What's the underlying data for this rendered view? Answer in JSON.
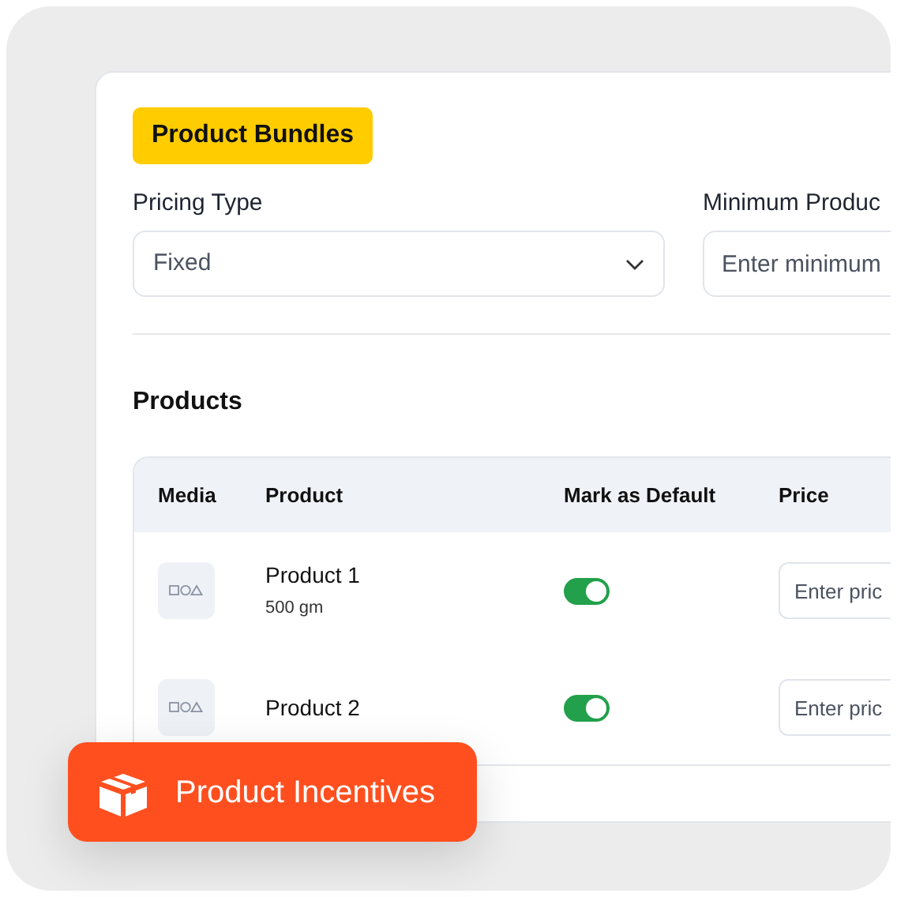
{
  "section_badge": "Product Bundles",
  "pricing_type": {
    "label": "Pricing Type",
    "value": "Fixed"
  },
  "minimum_products": {
    "label": "Minimum Produc",
    "placeholder": "Enter minimum"
  },
  "products": {
    "title": "Products",
    "columns": [
      "Media",
      "Product",
      "Mark as Default",
      "Price"
    ],
    "rows": [
      {
        "name": "Product 1",
        "detail": "500 gm",
        "default_on": true,
        "price_placeholder": "Enter pric"
      },
      {
        "name": "Product 2",
        "default_on": true,
        "price_placeholder": "Enter pric"
      }
    ]
  },
  "feature_badge": "Product Incentives"
}
